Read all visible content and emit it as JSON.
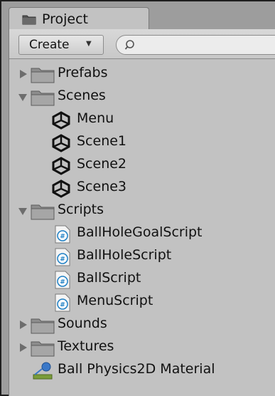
{
  "window": {
    "tab_label": "Project"
  },
  "toolbar": {
    "create_label": "Create",
    "search_value": ""
  },
  "tree": {
    "items": [
      {
        "label": "Prefabs",
        "kind": "folder",
        "expanded": false
      },
      {
        "label": "Scenes",
        "kind": "folder",
        "expanded": true
      },
      {
        "label": "Menu",
        "kind": "scene"
      },
      {
        "label": "Scene1",
        "kind": "scene"
      },
      {
        "label": "Scene2",
        "kind": "scene"
      },
      {
        "label": "Scene3",
        "kind": "scene"
      },
      {
        "label": "Scripts",
        "kind": "folder",
        "expanded": true
      },
      {
        "label": "BallHoleGoalScript",
        "kind": "script"
      },
      {
        "label": "BallHoleScript",
        "kind": "script"
      },
      {
        "label": "BallScript",
        "kind": "script"
      },
      {
        "label": "MenuScript",
        "kind": "script"
      },
      {
        "label": "Sounds",
        "kind": "folder",
        "expanded": false
      },
      {
        "label": "Textures",
        "kind": "folder",
        "expanded": false
      },
      {
        "label": "Ball Physics2D Material",
        "kind": "material"
      }
    ]
  },
  "icons": {
    "folder": "folder-icon",
    "scene": "unity-scene-icon",
    "script": "csharp-script-icon",
    "material": "physics-material-icon",
    "search": "search-icon",
    "dropdown": "dropdown-arrow-icon"
  },
  "colors": {
    "panel_bg": "#c2c2c2",
    "text": "#111111",
    "script_icon_accent": "#1d7fc4"
  }
}
